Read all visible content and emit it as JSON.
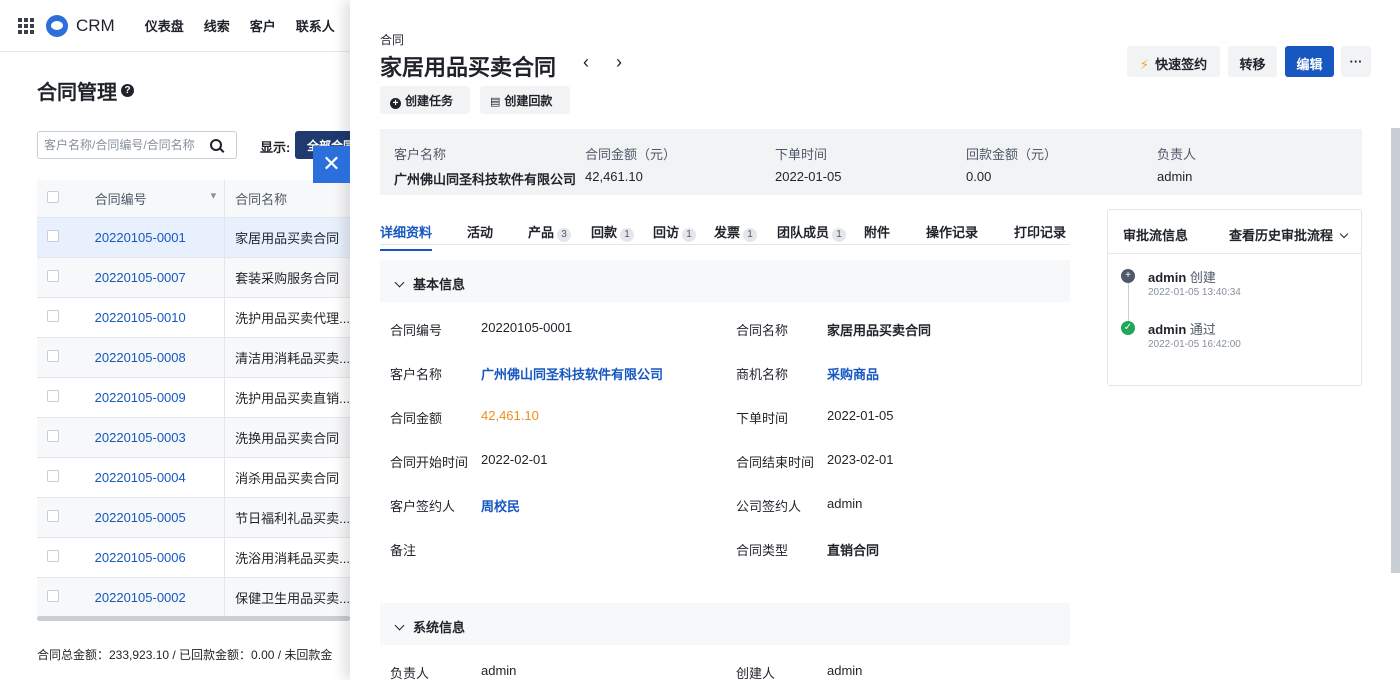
{
  "topnav": {
    "brand": "CRM",
    "items": [
      "仪表盘",
      "线索",
      "客户",
      "联系人"
    ]
  },
  "list_page": {
    "title": "合同管理",
    "search_placeholder": "客户名称/合同编号/合同名称",
    "show_label": "显示:",
    "show_value": "全部合同",
    "columns": [
      "合同编号",
      "合同名称"
    ],
    "rows": [
      {
        "number": "20220105-0001",
        "name": "家居用品买卖合同"
      },
      {
        "number": "20220105-0007",
        "name": "套装采购服务合同"
      },
      {
        "number": "20220105-0010",
        "name": "洗护用品买卖代理..."
      },
      {
        "number": "20220105-0008",
        "name": "清洁用消耗品买卖..."
      },
      {
        "number": "20220105-0009",
        "name": "洗护用品买卖直销..."
      },
      {
        "number": "20220105-0003",
        "name": "洗换用品买卖合同"
      },
      {
        "number": "20220105-0004",
        "name": "消杀用品买卖合同"
      },
      {
        "number": "20220105-0005",
        "name": "节日福利礼品买卖..."
      },
      {
        "number": "20220105-0006",
        "name": "洗浴用消耗品买卖..."
      },
      {
        "number": "20220105-0002",
        "name": "保健卫生用品买卖..."
      }
    ],
    "totals": "合同总金额：233,923.10 / 已回款金额：0.00 / 未回款金"
  },
  "drawer": {
    "type_label": "合同",
    "title": "家居用品买卖合同",
    "actions": {
      "create_task": "创建任务",
      "create_payment": "创建回款"
    },
    "top_buttons": {
      "quick_sign": "快速签约",
      "transfer": "转移",
      "edit": "编辑",
      "more": "···"
    },
    "summary": [
      {
        "label": "客户名称",
        "value": "广州佛山同圣科技软件有限公司"
      },
      {
        "label": "合同金额（元）",
        "value": "42,461.10"
      },
      {
        "label": "下单时间",
        "value": "2022-01-05"
      },
      {
        "label": "回款金额（元）",
        "value": "0.00"
      },
      {
        "label": "负责人",
        "value": "admin"
      }
    ],
    "tabs": [
      {
        "label": "详细资料",
        "count": ""
      },
      {
        "label": "活动",
        "count": ""
      },
      {
        "label": "产品",
        "count": "3"
      },
      {
        "label": "回款",
        "count": "1"
      },
      {
        "label": "回访",
        "count": "1"
      },
      {
        "label": "发票",
        "count": "1"
      },
      {
        "label": "团队成员",
        "count": "1"
      },
      {
        "label": "附件",
        "count": ""
      },
      {
        "label": "操作记录",
        "count": ""
      },
      {
        "label": "打印记录",
        "count": ""
      }
    ],
    "basic_section": "基本信息",
    "fields": {
      "contract_no_label": "合同编号",
      "contract_no": "20220105-0001",
      "contract_name_label": "合同名称",
      "contract_name": "家居用品买卖合同",
      "customer_label": "客户名称",
      "customer": "广州佛山同圣科技软件有限公司",
      "opportunity_label": "商机名称",
      "opportunity": "采购商品",
      "amount_label": "合同金额",
      "amount": "42,461.10",
      "order_date_label": "下单时间",
      "order_date": "2022-01-05",
      "start_label": "合同开始时间",
      "start": "2022-02-01",
      "end_label": "合同结束时间",
      "end": "2023-02-01",
      "cust_signer_label": "客户签约人",
      "cust_signer": "周校民",
      "comp_signer_label": "公司签约人",
      "comp_signer": "admin",
      "remark_label": "备注",
      "type_label": "合同类型",
      "type": "直销合同"
    },
    "system_section": "系统信息",
    "system_fields": {
      "owner_label": "负责人",
      "owner": "admin",
      "creator_label": "创建人",
      "creator": "admin"
    },
    "approval": {
      "title": "审批流信息",
      "history_link": "查看历史审批流程",
      "steps": [
        {
          "user": "admin",
          "action": "创建",
          "time": "2022-01-05 13:40:34"
        },
        {
          "user": "admin",
          "action": "通过",
          "time": "2022-01-05 16:42:00"
        }
      ]
    }
  }
}
